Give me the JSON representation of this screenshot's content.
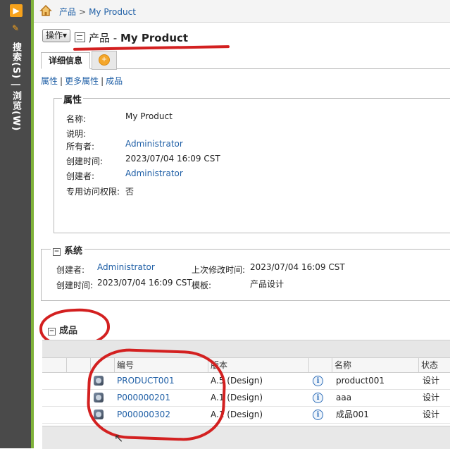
{
  "rail": {
    "text": "搜索(S) | 浏览(W)"
  },
  "breadcrumb": {
    "root": "产品",
    "sep": ">",
    "current": "My Product"
  },
  "header": {
    "actions_label": "操作▾",
    "title_prefix": "产品 - ",
    "title_object": "My Product"
  },
  "tabs": {
    "details": "详细信息",
    "add": "+"
  },
  "subnav": {
    "attributes": "属性",
    "more_attributes": "更多属性",
    "finished": "成品",
    "sep": "|"
  },
  "attributes": {
    "legend": "属性",
    "rows": [
      {
        "label": "名称:",
        "value": "My Product"
      },
      {
        "label": "说明:",
        "value": ""
      },
      {
        "label": "所有者:",
        "value": "Administrator"
      },
      {
        "label": "创建时间:",
        "value": "2023/07/04 16:09 CST"
      },
      {
        "label": "创建者:",
        "value": "Administrator"
      },
      {
        "label": "专用访问权限:",
        "value": "否"
      }
    ]
  },
  "system": {
    "legend": "系统",
    "creator_label": "创建者:",
    "creator_value": "Administrator",
    "created_label": "创建时间:",
    "created_value": "2023/07/04 16:09 CST",
    "modified_label": "上次修改时间:",
    "modified_value": "2023/07/04 16:09 CST",
    "template_label": "模板:",
    "template_value": "产品设计"
  },
  "finished": {
    "title": "成品",
    "columns": {
      "number": "编号",
      "version": "版本",
      "name": "名称",
      "state": "状态"
    },
    "rows": [
      {
        "number": "PRODUCT001",
        "version": "A.5 (Design)",
        "name": "product001",
        "state": "设计"
      },
      {
        "number": "P000000201",
        "version": "A.1 (Design)",
        "name": "aaa",
        "state": "设计"
      },
      {
        "number": "P000000302",
        "version": "A.1 (Design)",
        "name": "成品001",
        "state": "设计"
      }
    ]
  },
  "colors": {
    "link": "#1f5fa6",
    "accent_green": "#7fb23a",
    "annotation_red": "#d32020"
  },
  "icons": [
    "home-icon",
    "part-icon",
    "info-icon",
    "add-tab-icon"
  ]
}
